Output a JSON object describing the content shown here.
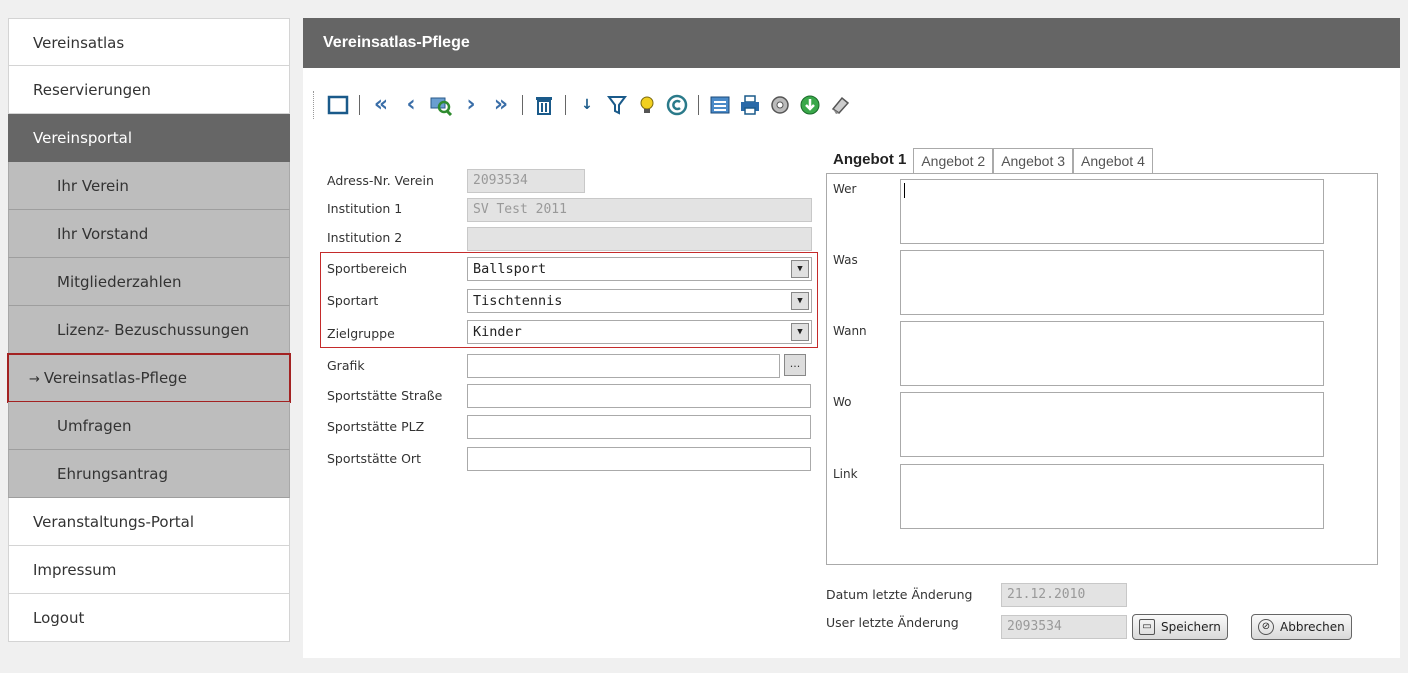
{
  "sidebar": {
    "items": [
      {
        "label": "Vereinsatlas"
      },
      {
        "label": "Reservierungen"
      },
      {
        "label": "Vereinsportal"
      },
      {
        "label": "Ihr Verein"
      },
      {
        "label": "Ihr Vorstand"
      },
      {
        "label": "Mitgliederzahlen"
      },
      {
        "label": "Lizenz- Bezuschussungen"
      },
      {
        "label": "Vereinsatlas-Pflege",
        "arrow": "→"
      },
      {
        "label": "Umfragen"
      },
      {
        "label": "Ehrungsantrag"
      },
      {
        "label": "Veranstaltungs-Portal"
      },
      {
        "label": "Impressum"
      },
      {
        "label": "Logout"
      }
    ]
  },
  "header": {
    "title": "Vereinsatlas-Pflege"
  },
  "toolbar": {
    "icons": [
      "new-record-icon",
      "first-record-icon",
      "previous-record-icon",
      "search-icon",
      "next-record-icon",
      "last-record-icon",
      "delete-icon",
      "sort-icon",
      "filter-icon",
      "tip-icon",
      "copyright-icon",
      "list-view-icon",
      "print-icon",
      "settings-icon",
      "download-icon",
      "eraser-icon"
    ]
  },
  "form": {
    "adress_label": "Adress-Nr. Verein",
    "adress_value": "2093534",
    "inst1_label": "Institution 1",
    "inst1_value": "SV Test 2011",
    "inst2_label": "Institution 2",
    "inst2_value": "",
    "sportbereich_label": "Sportbereich",
    "sportbereich_value": "Ballsport",
    "sportart_label": "Sportart",
    "sportart_value": "Tischtennis",
    "zielgruppe_label": "Zielgruppe",
    "zielgruppe_value": "Kinder",
    "grafik_label": "Grafik",
    "grafik_value": "",
    "browse_label": "...",
    "strasse_label": "Sportstätte Straße",
    "plz_label": "Sportstätte PLZ",
    "ort_label": "Sportstätte Ort"
  },
  "tabs": [
    {
      "label": "Angebot 1"
    },
    {
      "label": "Angebot 2"
    },
    {
      "label": "Angebot 3"
    },
    {
      "label": "Angebot 4"
    }
  ],
  "panel": {
    "wer": "Wer",
    "was": "Was",
    "wann": "Wann",
    "wo": "Wo",
    "link": "Link"
  },
  "footer": {
    "datum_label": "Datum letzte Änderung",
    "datum_value": "21.12.2010",
    "user_label": "User letzte Änderung",
    "user_value": "2093534",
    "save_label": "Speichern",
    "cancel_label": "Abbrechen"
  },
  "colors": {
    "titlebar": "#656565",
    "sidebar_dark": "#666666",
    "sidebar_sub": "#bdbdbd",
    "highlight": "#c42b2b"
  }
}
